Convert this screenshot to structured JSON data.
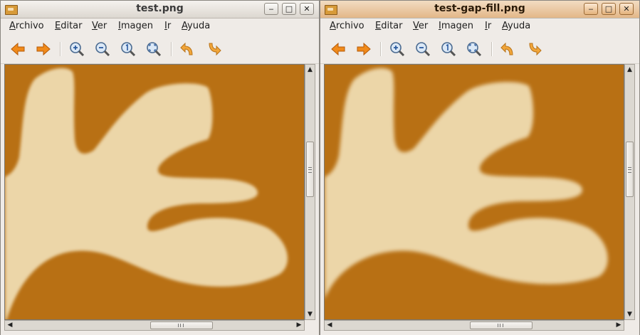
{
  "windows": [
    {
      "title": "test.png",
      "menu": [
        "Archivo",
        "Editar",
        "Ver",
        "Imagen",
        "Ir",
        "Ayuda"
      ],
      "toolbar": [
        "back-icon",
        "forward-icon",
        "zoom-in-icon",
        "zoom-out-icon",
        "zoom-normal-icon",
        "zoom-fit-icon",
        "rotate-left-icon",
        "rotate-right-icon"
      ],
      "controls": {
        "minimize": "‒",
        "maximize": "□",
        "close": "✕"
      },
      "image_colors": {
        "background": "#b87014",
        "shape": "#ecd6a8"
      }
    },
    {
      "title": "test-gap-fill.png",
      "menu": [
        "Archivo",
        "Editar",
        "Ver",
        "Imagen",
        "Ir",
        "Ayuda"
      ],
      "toolbar": [
        "back-icon",
        "forward-icon",
        "zoom-in-icon",
        "zoom-out-icon",
        "zoom-normal-icon",
        "zoom-fit-icon",
        "rotate-left-icon",
        "rotate-right-icon"
      ],
      "controls": {
        "minimize": "‒",
        "maximize": "□",
        "close": "✕"
      },
      "image_colors": {
        "background": "#b87014",
        "shape": "#ecd6a8"
      }
    }
  ],
  "scroll_arrows": {
    "up": "▲",
    "down": "▼",
    "left": "◀",
    "right": "▶"
  }
}
